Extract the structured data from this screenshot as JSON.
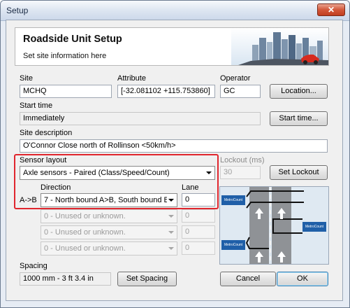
{
  "window": {
    "title": "Setup",
    "close_glyph": "✕"
  },
  "header": {
    "title": "Roadside Unit Setup",
    "subtitle": "Set site information here"
  },
  "site": {
    "label": "Site",
    "value": "MCHQ"
  },
  "attribute": {
    "label": "Attribute",
    "value": "[-32.081102 +115.753860]"
  },
  "operator": {
    "label": "Operator",
    "value": "GC"
  },
  "location_button": "Location...",
  "start_time": {
    "label": "Start time",
    "value": "Immediately",
    "button": "Start time..."
  },
  "site_description": {
    "label": "Site description",
    "value": "O'Connor Close north of Rollinson <50km/h>"
  },
  "sensor_layout": {
    "label": "Sensor layout",
    "value": "Axle sensors - Paired (Class/Speed/Count)"
  },
  "lockout": {
    "label": "Lockout (ms)",
    "value": "30",
    "button": "Set Lockout"
  },
  "direction": {
    "label": "Direction",
    "lane_label": "Lane",
    "row_label": "A->B",
    "value": "7 - North bound A>B, South bound B",
    "lane": "0",
    "unused": [
      {
        "value": "0 - Unused or unknown.",
        "lane": "0"
      },
      {
        "value": "0 - Unused or unknown.",
        "lane": "0"
      },
      {
        "value": "0 - Unused or unknown.",
        "lane": "0"
      }
    ]
  },
  "spacing": {
    "label": "Spacing",
    "value": "1000 mm - 3 ft 3.4 in",
    "button": "Set Spacing"
  },
  "buttons": {
    "cancel": "Cancel",
    "ok": "OK"
  },
  "diagram": {
    "logo_text": "MetroCount"
  }
}
